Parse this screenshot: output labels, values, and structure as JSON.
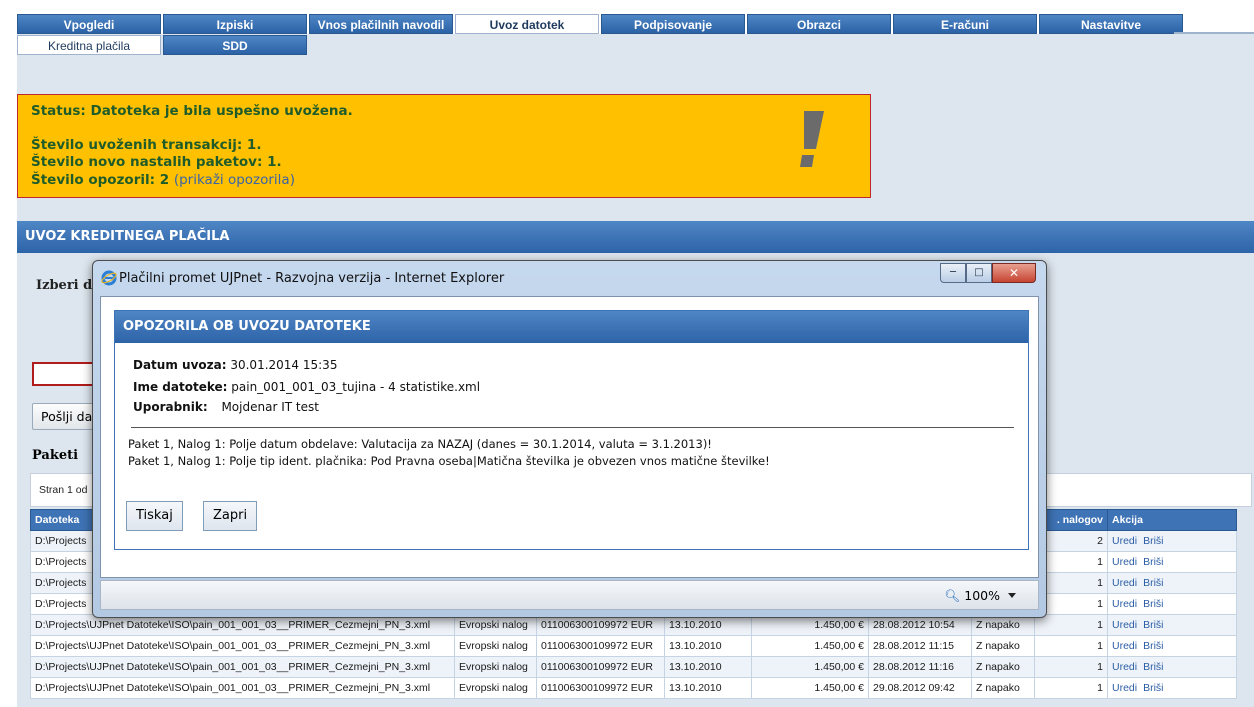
{
  "tabs": [
    "Vpogledi",
    "Izpiski",
    "Vnos plačilnih navodil",
    "Uvoz datotek",
    "Podpisovanje",
    "Obrazci",
    "E-računi",
    "Nastavitve"
  ],
  "subtabs": [
    "Kreditna plačila",
    "SDD"
  ],
  "status": {
    "line1": "Status: Datoteka je bila uspešno uvožena.",
    "line2": "Število uvoženih transakcij: 1.",
    "line3": "Število novo nastalih paketov: 1.",
    "line4_prefix": "Število opozoril: 2",
    "line4_link": "(prikaži opozorila)",
    "color": "#ffc000"
  },
  "section_title": "UVOZ KREDITNEGA PLAČILA",
  "izberi_label": "Izberi dat",
  "send_label": "Pošlji da",
  "paketi_label": "Paketi",
  "pager_text": "Stran 1 od",
  "table": {
    "headers": [
      "Datoteka",
      ". nalogov",
      "Akcija"
    ],
    "rows_top": [
      {
        "file": "D:\\Projects",
        "count": "2",
        "uredi": "Uredi",
        "brisi": "Briši"
      },
      {
        "file": "D:\\Projects",
        "count": "1",
        "uredi": "Uredi",
        "brisi": "Briši"
      },
      {
        "file": "D:\\Projects",
        "count": "1",
        "uredi": "Uredi",
        "brisi": "Briši"
      },
      {
        "file": "D:\\Projects",
        "count": "1",
        "uredi": "Uredi",
        "brisi": "Briši"
      }
    ],
    "rows_full": [
      {
        "file": "D:\\Projects\\UJPnet Datoteke\\ISO\\pain_001_001_03__PRIMER_Cezmejni_PN_3.xml",
        "type": "Evropski nalog",
        "account": "011006300109972 EUR",
        "date": "13.10.2010",
        "amount": "1.450,00 €",
        "created": "28.08.2012 10:54",
        "state": "Z napako",
        "count": "1",
        "uredi": "Uredi",
        "brisi": "Briši"
      },
      {
        "file": "D:\\Projects\\UJPnet Datoteke\\ISO\\pain_001_001_03__PRIMER_Cezmejni_PN_3.xml",
        "type": "Evropski nalog",
        "account": "011006300109972 EUR",
        "date": "13.10.2010",
        "amount": "1.450,00 €",
        "created": "28.08.2012 11:15",
        "state": "Z napako",
        "count": "1",
        "uredi": "Uredi",
        "brisi": "Briši"
      },
      {
        "file": "D:\\Projects\\UJPnet Datoteke\\ISO\\pain_001_001_03__PRIMER_Cezmejni_PN_3.xml",
        "type": "Evropski nalog",
        "account": "011006300109972 EUR",
        "date": "13.10.2010",
        "amount": "1.450,00 €",
        "created": "28.08.2012 11:16",
        "state": "Z napako",
        "count": "1",
        "uredi": "Uredi",
        "brisi": "Briši"
      },
      {
        "file": "D:\\Projects\\UJPnet Datoteke\\ISO\\pain_001_001_03__PRIMER_Cezmejni_PN_3.xml",
        "type": "Evropski nalog",
        "account": "011006300109972 EUR",
        "date": "13.10.2010",
        "amount": "1.450,00 €",
        "created": "29.08.2012 09:42",
        "state": "Z napako",
        "count": "1",
        "uredi": "Uredi",
        "brisi": "Briši"
      }
    ]
  },
  "popup": {
    "window_title": "Plačilni promet UJPnet - Razvojna verzija - Internet Explorer",
    "dialog_title": "OPOZORILA OB UVOZU DATOTEKE",
    "datum_label": "Datum uvoza:",
    "datum_value": "30.01.2014 15:35",
    "ime_label": "Ime datoteke:",
    "ime_value": "pain_001_001_03_tujina - 4 statistike.xml",
    "uporabnik_label": "Uporabnik:",
    "uporabnik_value": "Mojdenar IT test",
    "messages": [
      "Paket 1, Nalog 1: Polje datum obdelave: Valutacija za NAZAJ (danes = 30.1.2014, valuta = 3.1.2013)!",
      "Paket 1, Nalog 1: Polje tip ident. plačnika: Pod Pravna oseba|Matična številka je obvezen vnos matične številke!"
    ],
    "btn_print": "Tiskaj",
    "btn_close": "Zapri",
    "zoom": "100%"
  }
}
